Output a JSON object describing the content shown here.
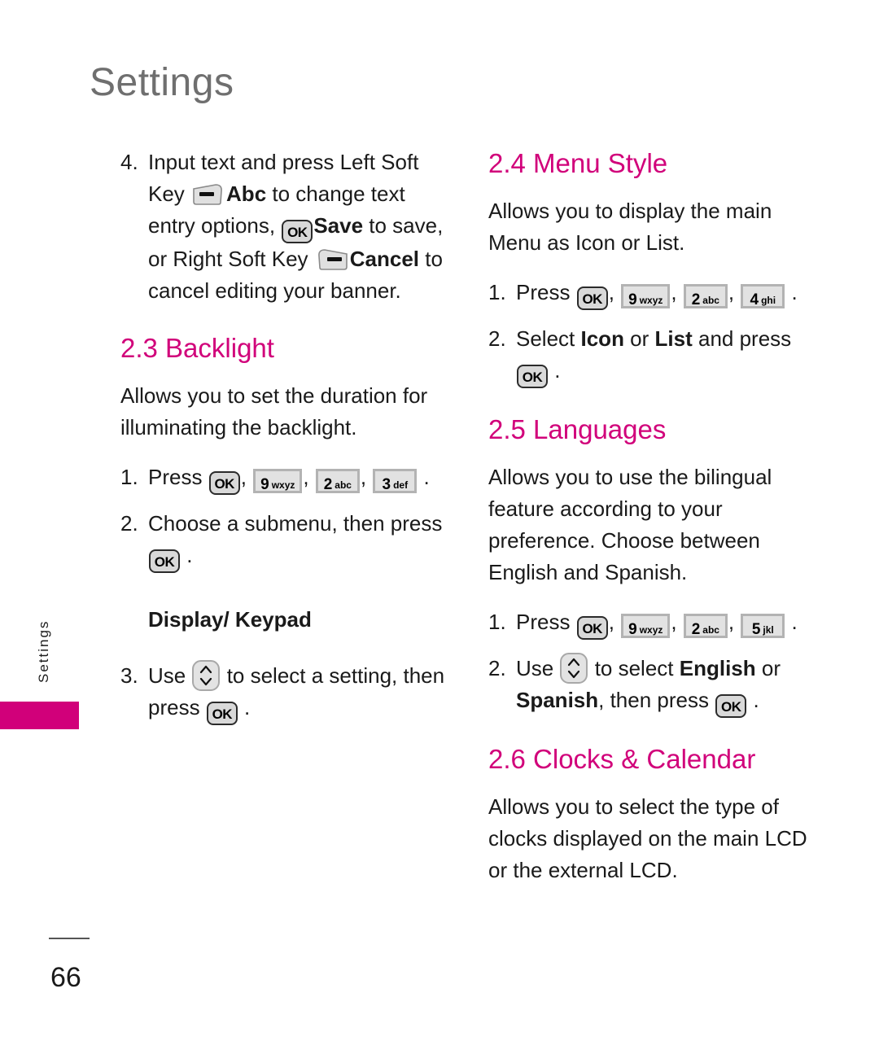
{
  "page": {
    "chapter_title": "Settings",
    "side_tab_label": "Settings",
    "page_number": "66",
    "accent_color": "#d1007a",
    "header_color": "#6f6f6f"
  },
  "keys": {
    "ok": "OK",
    "nav_updown": "nav-up-down",
    "left_soft": "left-soft-key",
    "right_soft": "right-soft-key",
    "k9": {
      "digit": "9",
      "letters": "wxyz"
    },
    "k2": {
      "digit": "2",
      "letters": "abc"
    },
    "k3": {
      "digit": "3",
      "letters": "def"
    },
    "k4": {
      "digit": "4",
      "letters": "ghi"
    },
    "k5": {
      "digit": "5",
      "letters": "jkl"
    }
  },
  "left_column": {
    "step4": {
      "num": "4.",
      "t1": "Input text and press Left Soft Key ",
      "b1": "Abc",
      "t2": " to change text entry options, ",
      "b2": "Save",
      "t3": " to save, or Right Soft Key ",
      "b3": "Cancel",
      "t4": " to cancel editing your banner."
    },
    "backlight": {
      "heading": "2.3 Backlight",
      "body": "Allows you to set the duration for illuminating the backlight.",
      "step1_num": "1.",
      "step1_label": "Press ",
      "step1_comma": ", ",
      "step1_period": " .",
      "step2_num": "2.",
      "step2_a": "Choose a submenu, then press ",
      "step2_b": " .",
      "subhead": "Display/ Keypad",
      "step3_num": "3.",
      "step3_a": "Use ",
      "step3_b": " to select a setting, then press ",
      "step3_c": " ."
    }
  },
  "right_column": {
    "menu_style": {
      "heading": "2.4 Menu Style",
      "body": "Allows you to display the main Menu as Icon or List.",
      "step1_num": "1.",
      "step1_label": "Press ",
      "step1_comma": ", ",
      "step1_period": " .",
      "step2_num": "2.",
      "step2_a": "Select ",
      "step2_b1": "Icon",
      "step2_mid": " or ",
      "step2_b2": "List",
      "step2_c": " and press ",
      "step2_d": " ."
    },
    "languages": {
      "heading": "2.5 Languages",
      "body": "Allows you to use the bilingual feature according to your preference. Choose between English and Spanish.",
      "step1_num": "1.",
      "step1_label": "Press ",
      "step1_comma": ", ",
      "step1_period": " .",
      "step2_num": "2.",
      "step2_a": "Use ",
      "step2_b": " to select ",
      "step2_bold1": "English",
      "step2_mid": " or ",
      "step2_bold2": "Spanish",
      "step2_c": ", then press ",
      "step2_d": " ."
    },
    "clocks_calendar": {
      "heading": "2.6 Clocks & Calendar",
      "body": "Allows you to select the type of clocks displayed on the main LCD or the external LCD."
    }
  }
}
